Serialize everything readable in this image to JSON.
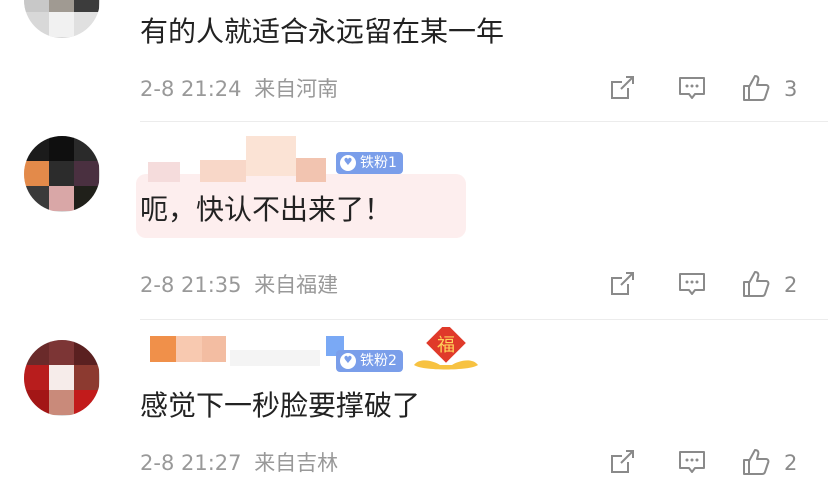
{
  "comments": [
    {
      "text": "有的人就适合永远留在某一年",
      "time": "2-8 21:24",
      "location": "来自河南",
      "likes": "3"
    },
    {
      "badge": "铁粉1",
      "text": "呃，快认不出来了！",
      "time": "2-8 21:35",
      "location": "来自福建",
      "likes": "2",
      "festival_badge": "福"
    },
    {
      "badge": "铁粉2",
      "text": "感觉下一秒脸要撑破了",
      "time": "2-8 21:27",
      "location": "来自吉林",
      "likes": "2"
    }
  ],
  "icons": {
    "share": "share-icon",
    "comment": "comment-icon",
    "like": "thumbs-up-icon",
    "badge": "fan-icon"
  },
  "colors": {
    "text": "#222222",
    "meta": "#999999",
    "badge": "#7a9eea",
    "divider": "#ececec"
  }
}
